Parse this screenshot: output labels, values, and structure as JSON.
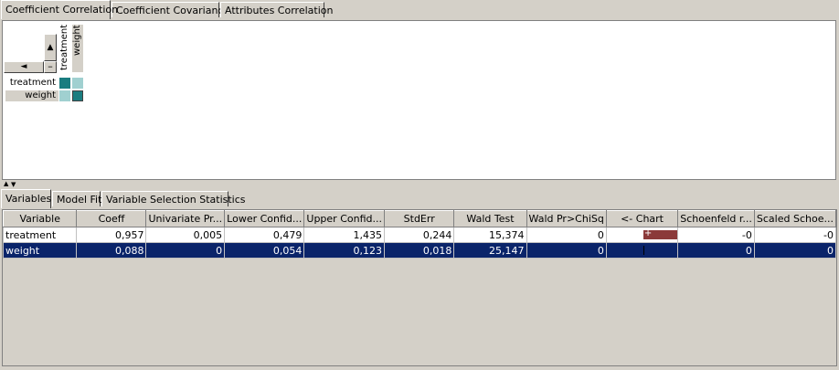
{
  "top_tabs": [
    {
      "label": "Coefficient Correlation",
      "active": true
    },
    {
      "label": "Coefficient Covariance",
      "active": false
    },
    {
      "label": "Attributes Correlation",
      "active": false
    }
  ],
  "matrix": {
    "scroll_up": "▲",
    "scroll_left": "◄",
    "collapse": "–",
    "columns": [
      "treatment",
      "weight"
    ],
    "rows": [
      "treatment",
      "weight"
    ],
    "cell_colors": {
      "diagonal": "#1a7d80",
      "off_diagonal": "#a0d0d0"
    }
  },
  "splitter": {
    "up": "▲",
    "down": "▼"
  },
  "bottom_tabs": [
    {
      "label": "Variables",
      "active": true
    },
    {
      "label": "Model Fit",
      "active": false
    },
    {
      "label": "Variable Selection Statistics",
      "active": false
    }
  ],
  "table": {
    "headers": [
      "Variable",
      "Coeff",
      "Univariate Pr...",
      "Lower Confid...",
      "Upper Confid...",
      "StdErr",
      "Wald Test",
      "Wald Pr>ChiSq",
      "<- Chart",
      "Schoenfeld r...",
      "Scaled Schoe..."
    ],
    "rows": [
      {
        "cells": [
          "treatment",
          "0,957",
          "0,005",
          "0,479",
          "1,435",
          "0,244",
          "15,374",
          "0",
          "",
          "-0",
          "-0"
        ],
        "chart_bar": 0.957,
        "chart_marker": "+"
      },
      {
        "cells": [
          "weight",
          "0,088",
          "0",
          "0,054",
          "0,123",
          "0,018",
          "25,147",
          "0",
          "",
          "0",
          "0"
        ],
        "chart_bar": 0.088,
        "chart_marker": ""
      }
    ]
  },
  "colors": {
    "selection": "#0a246a",
    "chart_bar": "#8b3a3a",
    "panel_bg": "#d4d0c8"
  }
}
